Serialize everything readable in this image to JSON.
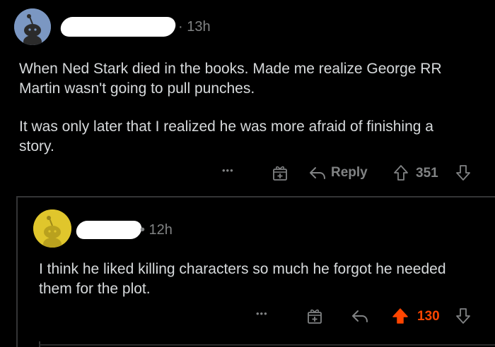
{
  "comment1": {
    "time": "· 13h",
    "paragraph1": "When Ned Stark died in the books. Made me realize George RR Martin wasn't going to pull punches.",
    "paragraph2": "It was only later that I realized he was more afraid of finishing a story.",
    "more": "•••",
    "reply_label": "Reply",
    "score": "351",
    "avatar_color": "#6b8bb8"
  },
  "comment2": {
    "time": "• 12h",
    "text": "I think he liked killing characters so much he forgot he needed them for the plot.",
    "more": "•••",
    "score": "130",
    "avatar_color": "#e0c62c",
    "upvote_color": "#ff4500"
  },
  "icons": [
    "more-options-icon",
    "award-icon",
    "reply-icon",
    "upvote-icon",
    "downvote-icon"
  ]
}
